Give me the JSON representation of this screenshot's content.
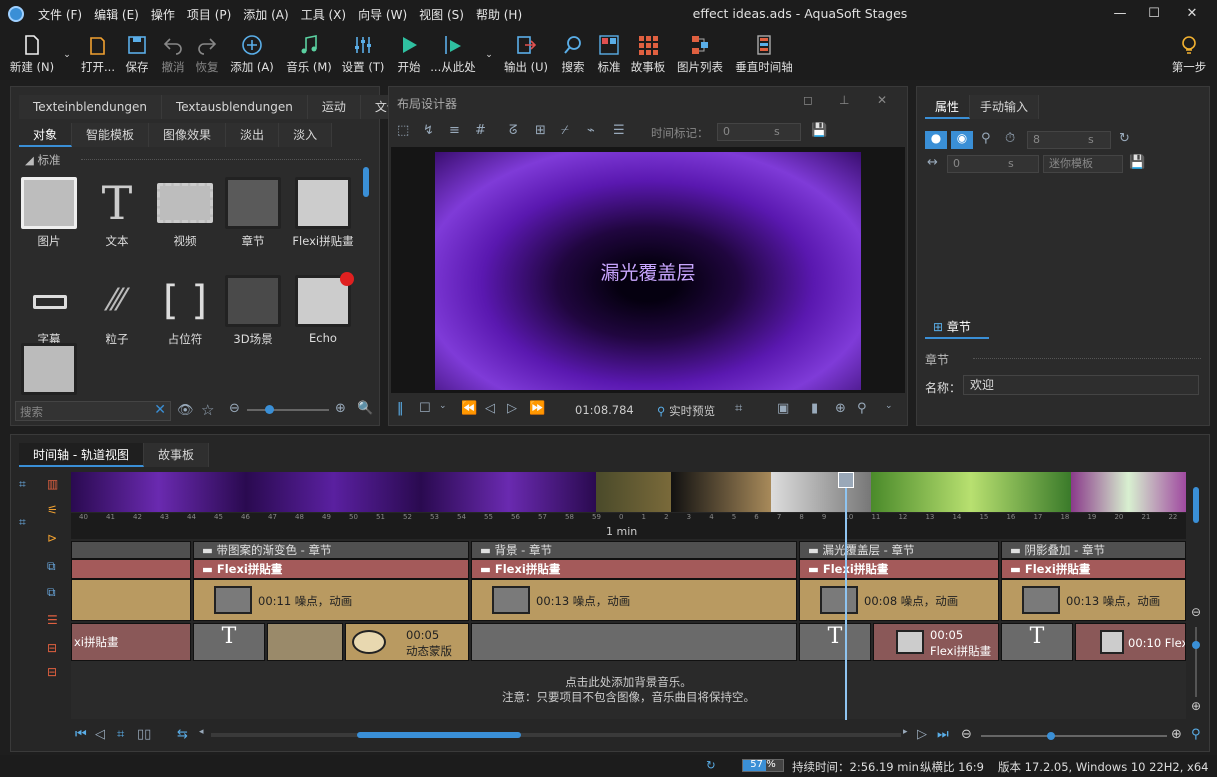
{
  "menu": [
    "文件 (F)",
    "编辑 (E)",
    "操作",
    "项目 (P)",
    "添加 (A)",
    "工具 (X)",
    "向导 (W)",
    "视图 (S)",
    "帮助 (H)"
  ],
  "window_title": "effect ideas.ads - AquaSoft Stages",
  "toolbar": {
    "new": "新建 (N)",
    "open": "打开...",
    "save": "保存",
    "undo": "撤消",
    "redo": "恢复",
    "add": "添加 (A)",
    "music": "音乐 (M)",
    "settings": "设置 (T)",
    "start": "开始",
    "from_here": "...从此处",
    "export": "输出 (U)",
    "search": "搜索",
    "standard": "标准",
    "storyboard": "故事板",
    "image_list": "图片列表",
    "vertical_timeline": "垂直时间轴",
    "first_step": "第一步"
  },
  "left_panel": {
    "tabs_top": [
      "Texteinblendungen",
      "Textausblendungen",
      "运动",
      "文件"
    ],
    "tabs_bottom": [
      "对象",
      "智能模板",
      "图像效果",
      "淡出",
      "淡入"
    ],
    "section": "标准",
    "objects": [
      "图片",
      "文本",
      "视频",
      "章节",
      "Flexi拼贴畫",
      "字幕",
      "粒子",
      "占位符",
      "3D场景",
      "Echo"
    ],
    "search_placeholder": "搜索"
  },
  "layout_designer": {
    "title": "布局设计器",
    "time_marker_label": "时间标记：",
    "time_value": "0",
    "time_unit": "s",
    "preview_text": "漏光覆盖层",
    "timecode": "01:08.784",
    "live_preview": "实时预览"
  },
  "properties": {
    "tabs": [
      "属性",
      "手动输入"
    ],
    "field1_value": "8",
    "field1_unit": "s",
    "field2_value": "0",
    "field2_unit": "s",
    "mini_template": "迷你模板",
    "chapter_tab": "章节",
    "chapter_heading": "章节",
    "name_label": "名称：",
    "name_value": "欢迎"
  },
  "timeline": {
    "tabs": [
      "时间轴 - 轨道视图",
      "故事板"
    ],
    "ticks": [
      "40",
      "41",
      "42",
      "43",
      "44",
      "45",
      "46",
      "47",
      "48",
      "49",
      "50",
      "51",
      "52",
      "53",
      "54",
      "55",
      "56",
      "57",
      "58",
      "59",
      "0",
      "1",
      "2",
      "3",
      "4",
      "5",
      "6",
      "7",
      "8",
      "9",
      "10",
      "11",
      "12",
      "13",
      "14",
      "15",
      "16",
      "17",
      "18",
      "19",
      "20",
      "21",
      "22"
    ],
    "minute_label": "1 min",
    "chapters": [
      "带图案的渐变色 - 章节",
      "背景 - 章节",
      "漏光覆盖层 - 章节",
      "阴影叠加 - 章节"
    ],
    "flexi_label": "Flexi拼貼畫",
    "noise_items": [
      "00:11 噪点，动画",
      "00:13 噪点，动画",
      "00:08 噪点，动画",
      "00:13 噪点，动画"
    ],
    "left_clip_label": "xi拼貼畫",
    "mask_clip_time": "00:05",
    "mask_clip_label": "动态蒙版",
    "flexi_clip_time": "00:05",
    "flexi_clip_label": "Flexi拼貼畫",
    "last_clip_label": "00:10 Flex",
    "music_hint_1": "点击此处添加背景音乐。",
    "music_hint_2": "注意：只要项目不包含图像，音乐曲目将保持空。"
  },
  "status": {
    "zoom": "57 %",
    "duration": "持续时间：2:56.19 min",
    "aspect": "纵横比 16:9",
    "version": "版本 17.2.05, Windows 10 22H2, x64"
  },
  "colors": {
    "accent": "#3a8fd6",
    "chapter": "#505050",
    "flexi": "#a45a5a",
    "noise": "#b99a61",
    "playhead": "#8fc4f0"
  }
}
